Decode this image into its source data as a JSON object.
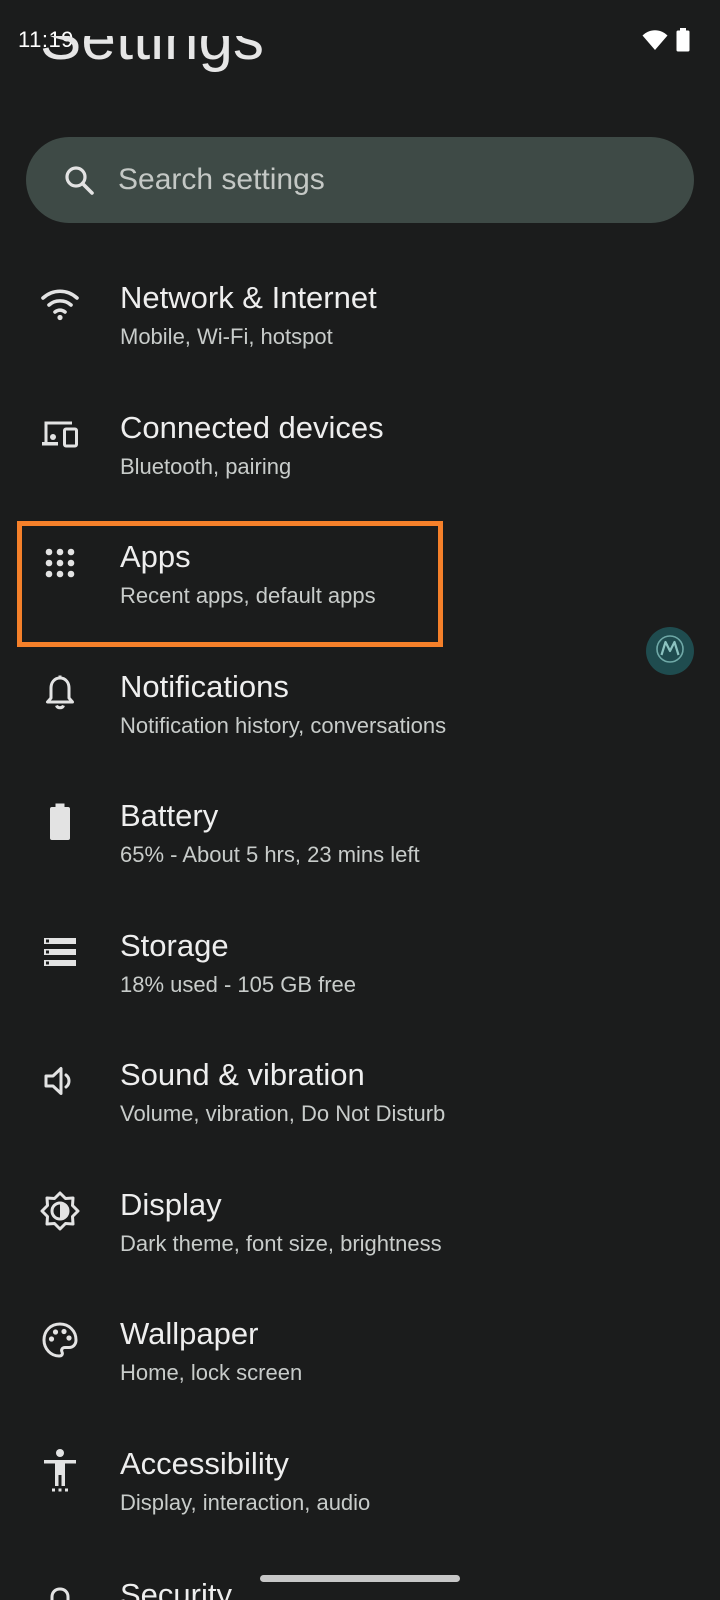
{
  "status_bar": {
    "time": "11:19",
    "icons": [
      "wifi-icon",
      "battery-icon"
    ]
  },
  "header": {
    "title": "Settings"
  },
  "search": {
    "placeholder": "Search settings",
    "icon": "search-icon"
  },
  "settings": {
    "items": [
      {
        "title": "Network & Internet",
        "subtitle": "Mobile, Wi-Fi, hotspot",
        "icon": "wifi-icon"
      },
      {
        "title": "Connected devices",
        "subtitle": "Bluetooth, pairing",
        "icon": "devices-icon"
      },
      {
        "title": "Apps",
        "subtitle": "Recent apps, default apps",
        "icon": "apps-grid-icon"
      },
      {
        "title": "Notifications",
        "subtitle": "Notification history, conversations",
        "icon": "bell-icon"
      },
      {
        "title": "Battery",
        "subtitle": "65% - About 5 hrs, 23 mins left",
        "icon": "battery-icon"
      },
      {
        "title": "Storage",
        "subtitle": "18% used - 105 GB free",
        "icon": "storage-icon"
      },
      {
        "title": "Sound & vibration",
        "subtitle": "Volume, vibration, Do Not Disturb",
        "icon": "speaker-icon"
      },
      {
        "title": "Display",
        "subtitle": "Dark theme, font size, brightness",
        "icon": "brightness-icon"
      },
      {
        "title": "Wallpaper",
        "subtitle": "Home, lock screen",
        "icon": "palette-icon"
      },
      {
        "title": "Accessibility",
        "subtitle": "Display, interaction, audio",
        "icon": "accessibility-icon"
      },
      {
        "title": "Security",
        "subtitle": "",
        "icon": "lock-icon"
      }
    ]
  },
  "highlight": {
    "target": "Apps",
    "color": "#f5802a"
  },
  "floating_badge": {
    "icon": "motorola-logo-icon",
    "color": "#1f4c4f"
  },
  "colors": {
    "background": "#1b1c1c",
    "search_bar": "#3e4a46",
    "text_primary": "#eeeeee",
    "text_secondary": "#c8ccca"
  }
}
